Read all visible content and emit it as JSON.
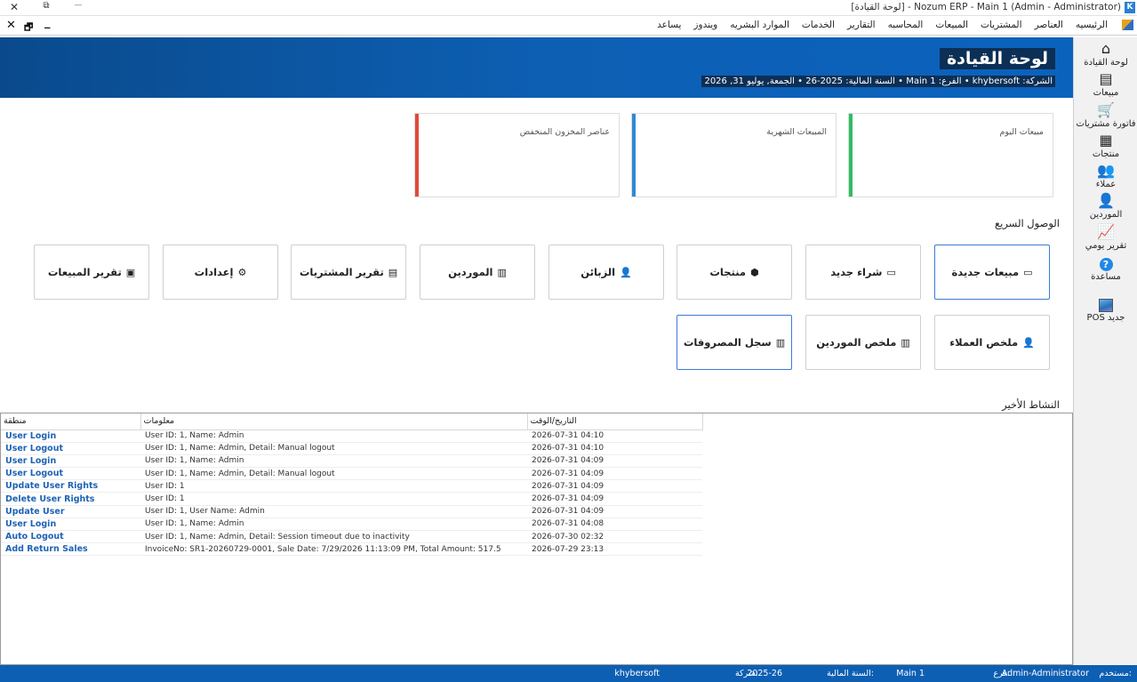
{
  "window": {
    "title": "Nozum ERP - Main 1 (Admin - Administrator) - [لوحة القيادة]",
    "app_badge": "K",
    "ctrl_close": "✕",
    "ctrl_restore": "⧉",
    "ctrl_minimize": "—"
  },
  "mdi_controls": {
    "close": "✕",
    "restore": "🗗",
    "minimize": "_"
  },
  "menu": [
    "الرئيسيه",
    "العناصر",
    "المشتريات",
    "المبيعات",
    "المحاسبه",
    "التقارير",
    "الخدمات",
    "الموارد البشريه",
    "ويندوز",
    "يساعد"
  ],
  "header": {
    "title": "لوحة القيادة",
    "subtitle": "الشركة: khybersoft • الفرع: Main 1 • السنة المالية: 2025-26 • الجمعة, يوليو 31, 2026"
  },
  "sidebar": [
    {
      "label": "لوحة القيادة",
      "icon": "home-icon",
      "glyph": "⌂"
    },
    {
      "label": "مبيعات",
      "icon": "sales-book-icon",
      "glyph": "▤"
    },
    {
      "label": "فاتورة مشتريات",
      "icon": "cart-icon",
      "glyph": "🛒"
    },
    {
      "label": "منتجات",
      "icon": "basket-icon",
      "glyph": "▦"
    },
    {
      "label": "عملاء",
      "icon": "customers-icon",
      "glyph": "👥"
    },
    {
      "label": "الموردين",
      "icon": "supplier-icon",
      "glyph": "👤"
    },
    {
      "label": "تقرير يومي",
      "icon": "daily-report-icon",
      "glyph": "📈"
    },
    {
      "label": "مساعدة",
      "icon": "help-icon",
      "glyph": "?"
    },
    {
      "label": "POS جديد",
      "icon": "pos-icon",
      "glyph": ""
    }
  ],
  "stats": [
    {
      "label": "مبيعات اليوم",
      "color": "#2ebd63"
    },
    {
      "label": "المبيعات الشهرية",
      "color": "#2d8ad7"
    },
    {
      "label": "عناصر المخزون المنخفض",
      "color": "#e04a3a"
    }
  ],
  "quick_access": {
    "title": "الوصول السريع",
    "row1": [
      {
        "label": "مبيعات جديدة",
        "icon": "sales-card-icon",
        "glyph": "▭"
      },
      {
        "label": "شراء جديد",
        "icon": "purchase-card-icon",
        "glyph": "▭"
      },
      {
        "label": "منتجات",
        "icon": "box-icon",
        "glyph": "⬢"
      },
      {
        "label": "الزبائن",
        "icon": "customer-icon",
        "glyph": "👤"
      },
      {
        "label": "الموردين",
        "icon": "suppliers-icon",
        "glyph": "▥"
      },
      {
        "label": "تقرير المشتريات",
        "icon": "purchase-report-icon",
        "glyph": "▤"
      },
      {
        "label": "إعدادات",
        "icon": "gear-icon",
        "glyph": "⚙"
      },
      {
        "label": "تقرير المبيعات",
        "icon": "sales-report-icon",
        "glyph": "▣"
      }
    ],
    "row2": [
      {
        "label": "ملخص العملاء",
        "icon": "customer-summary-icon",
        "glyph": "👤"
      },
      {
        "label": "ملخص الموردين",
        "icon": "supplier-summary-icon",
        "glyph": "▥"
      },
      {
        "label": "سجل المصروفات",
        "icon": "expense-log-icon",
        "glyph": "▥"
      }
    ]
  },
  "activity": {
    "title": "النشاط الأخير",
    "columns": [
      "منطقة",
      "معلومات",
      "التاريخ/الوقت"
    ],
    "rows": [
      [
        "User Login",
        "User ID: 1, Name: Admin",
        "2026-07-31 04:10"
      ],
      [
        "User Logout",
        "User ID: 1, Name: Admin, Detail: Manual logout",
        "2026-07-31 04:10"
      ],
      [
        "User Login",
        "User ID: 1, Name: Admin",
        "2026-07-31 04:09"
      ],
      [
        "User Logout",
        "User ID: 1, Name: Admin, Detail: Manual logout",
        "2026-07-31 04:09"
      ],
      [
        "Update User Rights",
        "User ID: 1",
        "2026-07-31 04:09"
      ],
      [
        "Delete User Rights",
        "User ID: 1",
        "2026-07-31 04:09"
      ],
      [
        "Update User",
        "User ID: 1, User Name: Admin",
        "2026-07-31 04:09"
      ],
      [
        "User Login",
        "User ID: 1, Name: Admin",
        "2026-07-31 04:08"
      ],
      [
        "Auto Logout",
        "User ID: 1, Name: Admin, Detail: Session timeout due to inactivity",
        "2026-07-30 02:32"
      ],
      [
        "Add Return Sales",
        "InvoiceNo: SR1-20260729-0001, Sale Date: 7/29/2026 11:13:09 PM, Total Amount: 517.5",
        "2026-07-29 23:13"
      ]
    ]
  },
  "status": {
    "user_label": "مستخدم:",
    "user_value": "Admin-Administrator",
    "branch_label": "فرع:",
    "branch_value": "Main 1",
    "year_label": "السنة المالية:",
    "year_value": "2025-26",
    "company_label": "شركة:",
    "company_value": "khybersoft"
  }
}
